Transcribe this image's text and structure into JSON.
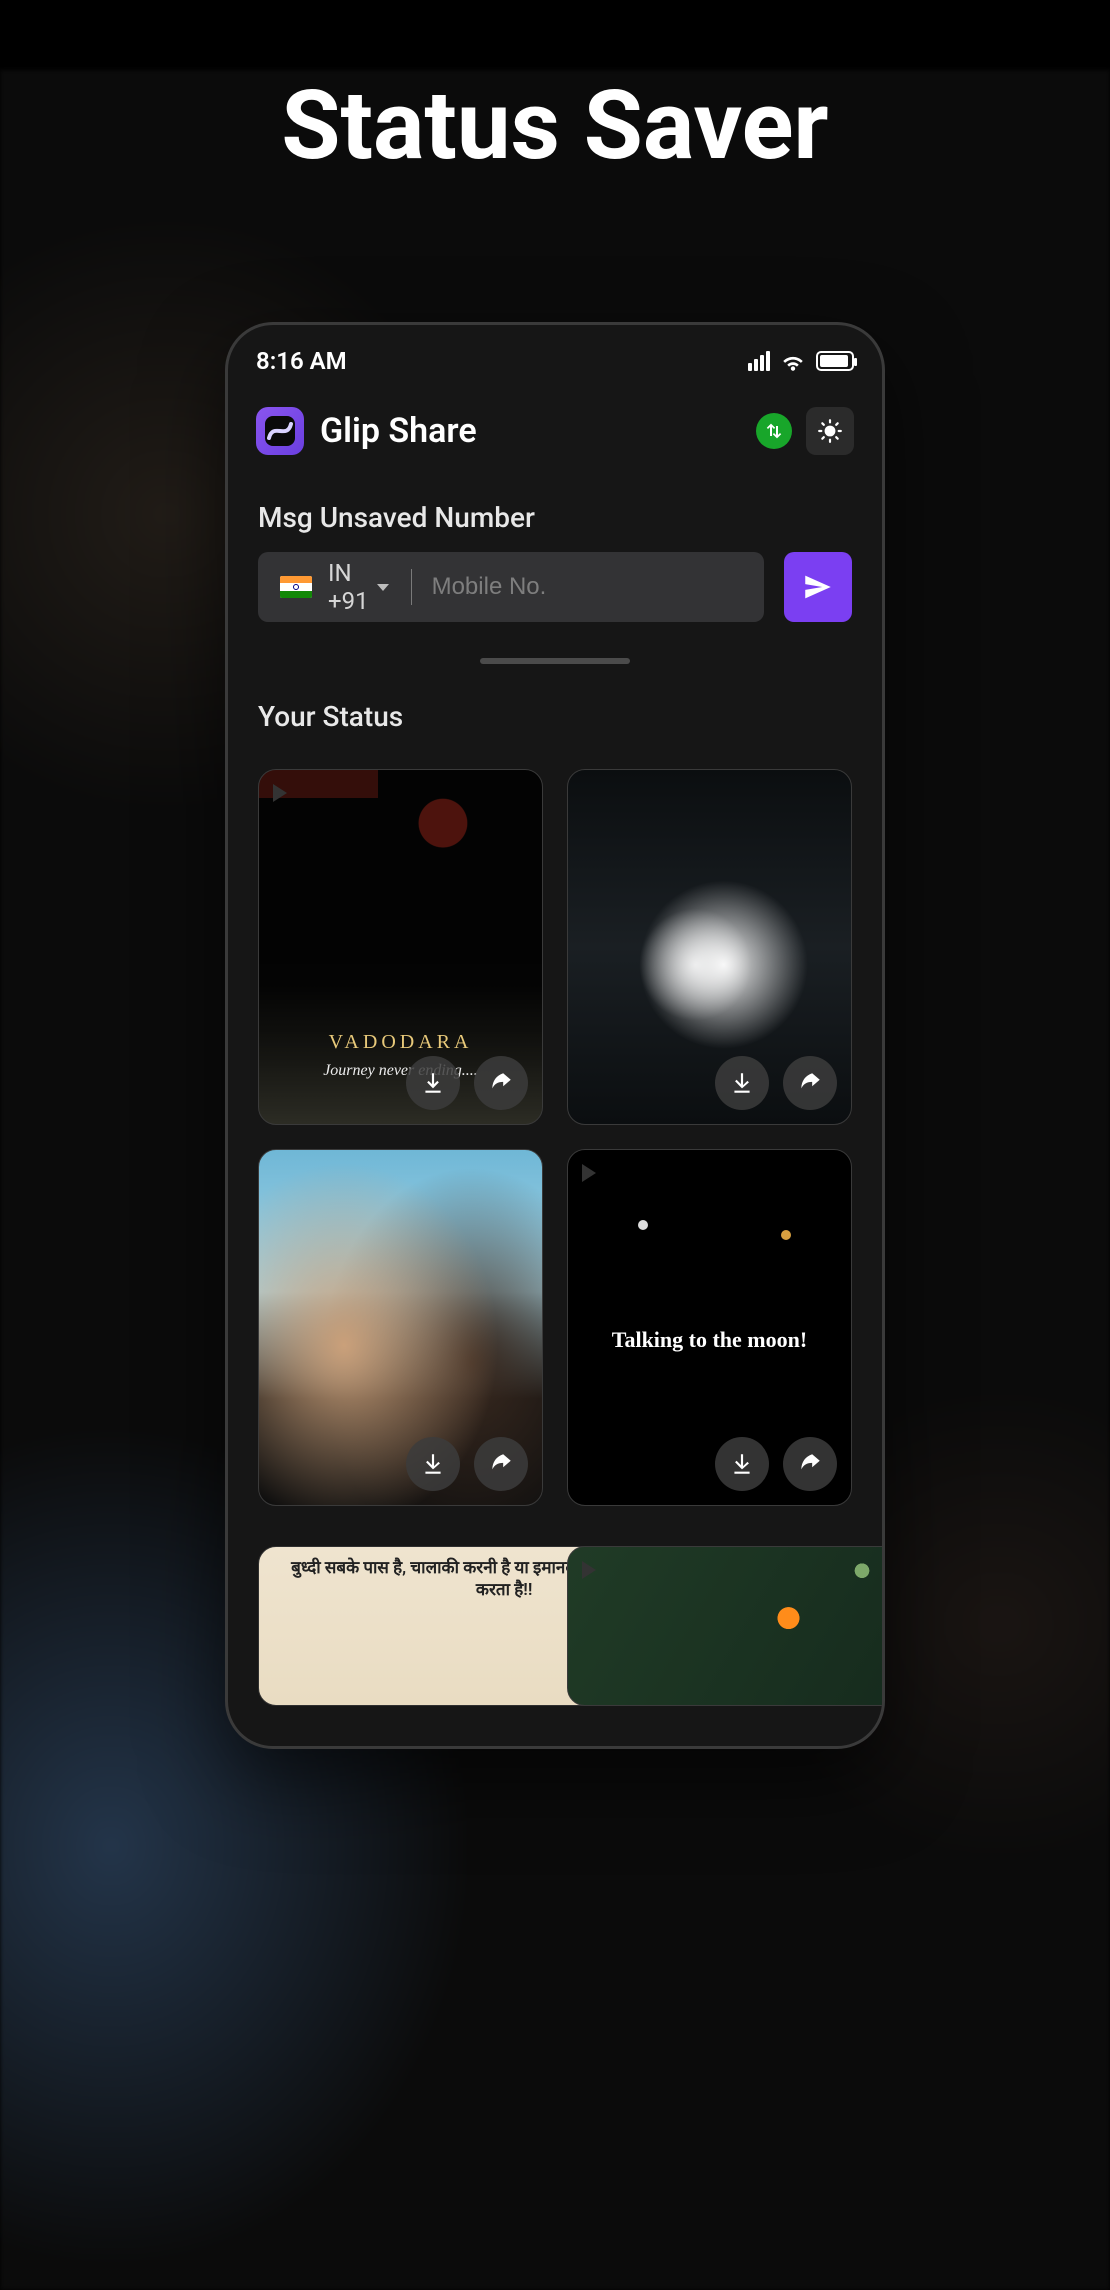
{
  "page_heading": "Status Saver",
  "status_bar": {
    "time": "8:16 AM"
  },
  "app": {
    "title": "Glip Share"
  },
  "unsaved": {
    "label": "Msg Unsaved Number",
    "country_code_label": "IN  +91",
    "placeholder": "Mobile No."
  },
  "your_status_label": "Your Status",
  "cards": {
    "c1_title": "VADODARA",
    "c1_sub": "Journey never ending....",
    "c4_text": "Talking to the moon!",
    "c5_text": "बुध्दी सबके पास है, चालाकी करनी है या इमानदारी, ये संस्कारो पर निर्भर करता है!!"
  }
}
